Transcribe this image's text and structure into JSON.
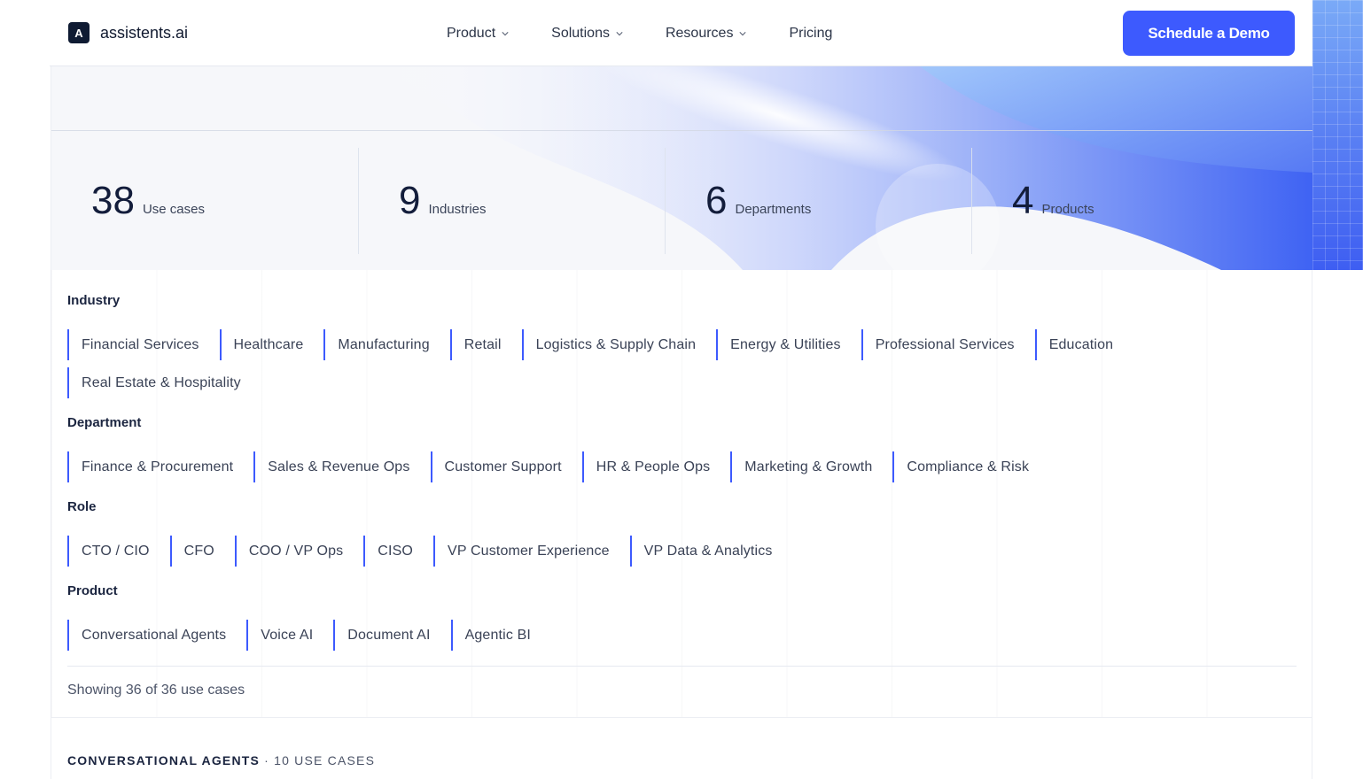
{
  "brand": {
    "logo_letter": "A",
    "name": "assistents.ai"
  },
  "nav": [
    {
      "label": "Product",
      "has_dropdown": true
    },
    {
      "label": "Solutions",
      "has_dropdown": true
    },
    {
      "label": "Resources",
      "has_dropdown": true
    },
    {
      "label": "Pricing",
      "has_dropdown": false
    }
  ],
  "cta": {
    "label": "Schedule a Demo",
    "color": "#3d5afe"
  },
  "stats": [
    {
      "value": "38",
      "label": "Use cases"
    },
    {
      "value": "9",
      "label": "Industries"
    },
    {
      "value": "6",
      "label": "Departments"
    },
    {
      "value": "4",
      "label": "Products"
    }
  ],
  "filters": {
    "industry": {
      "title": "Industry",
      "options": [
        "Financial Services",
        "Healthcare",
        "Manufacturing",
        "Retail",
        "Logistics & Supply Chain",
        "Energy & Utilities",
        "Professional Services",
        "Education",
        "Real Estate & Hospitality"
      ]
    },
    "department": {
      "title": "Department",
      "options": [
        "Finance & Procurement",
        "Sales & Revenue Ops",
        "Customer Support",
        "HR & People Ops",
        "Marketing & Growth",
        "Compliance & Risk"
      ]
    },
    "role": {
      "title": "Role",
      "options": [
        "CTO / CIO",
        "CFO",
        "COO / VP Ops",
        "CISO",
        "VP Customer Experience",
        "VP Data & Analytics"
      ]
    },
    "product": {
      "title": "Product",
      "options": [
        "Conversational Agents",
        "Voice AI",
        "Document AI",
        "Agentic BI"
      ]
    }
  },
  "results": {
    "text": "Showing 36 of 36 use cases"
  },
  "section": {
    "title": "CONVERSATIONAL AGENTS",
    "count": "· 10 USE CASES"
  },
  "colors": {
    "accent": "#3d5afe",
    "ink": "#131d3b"
  }
}
